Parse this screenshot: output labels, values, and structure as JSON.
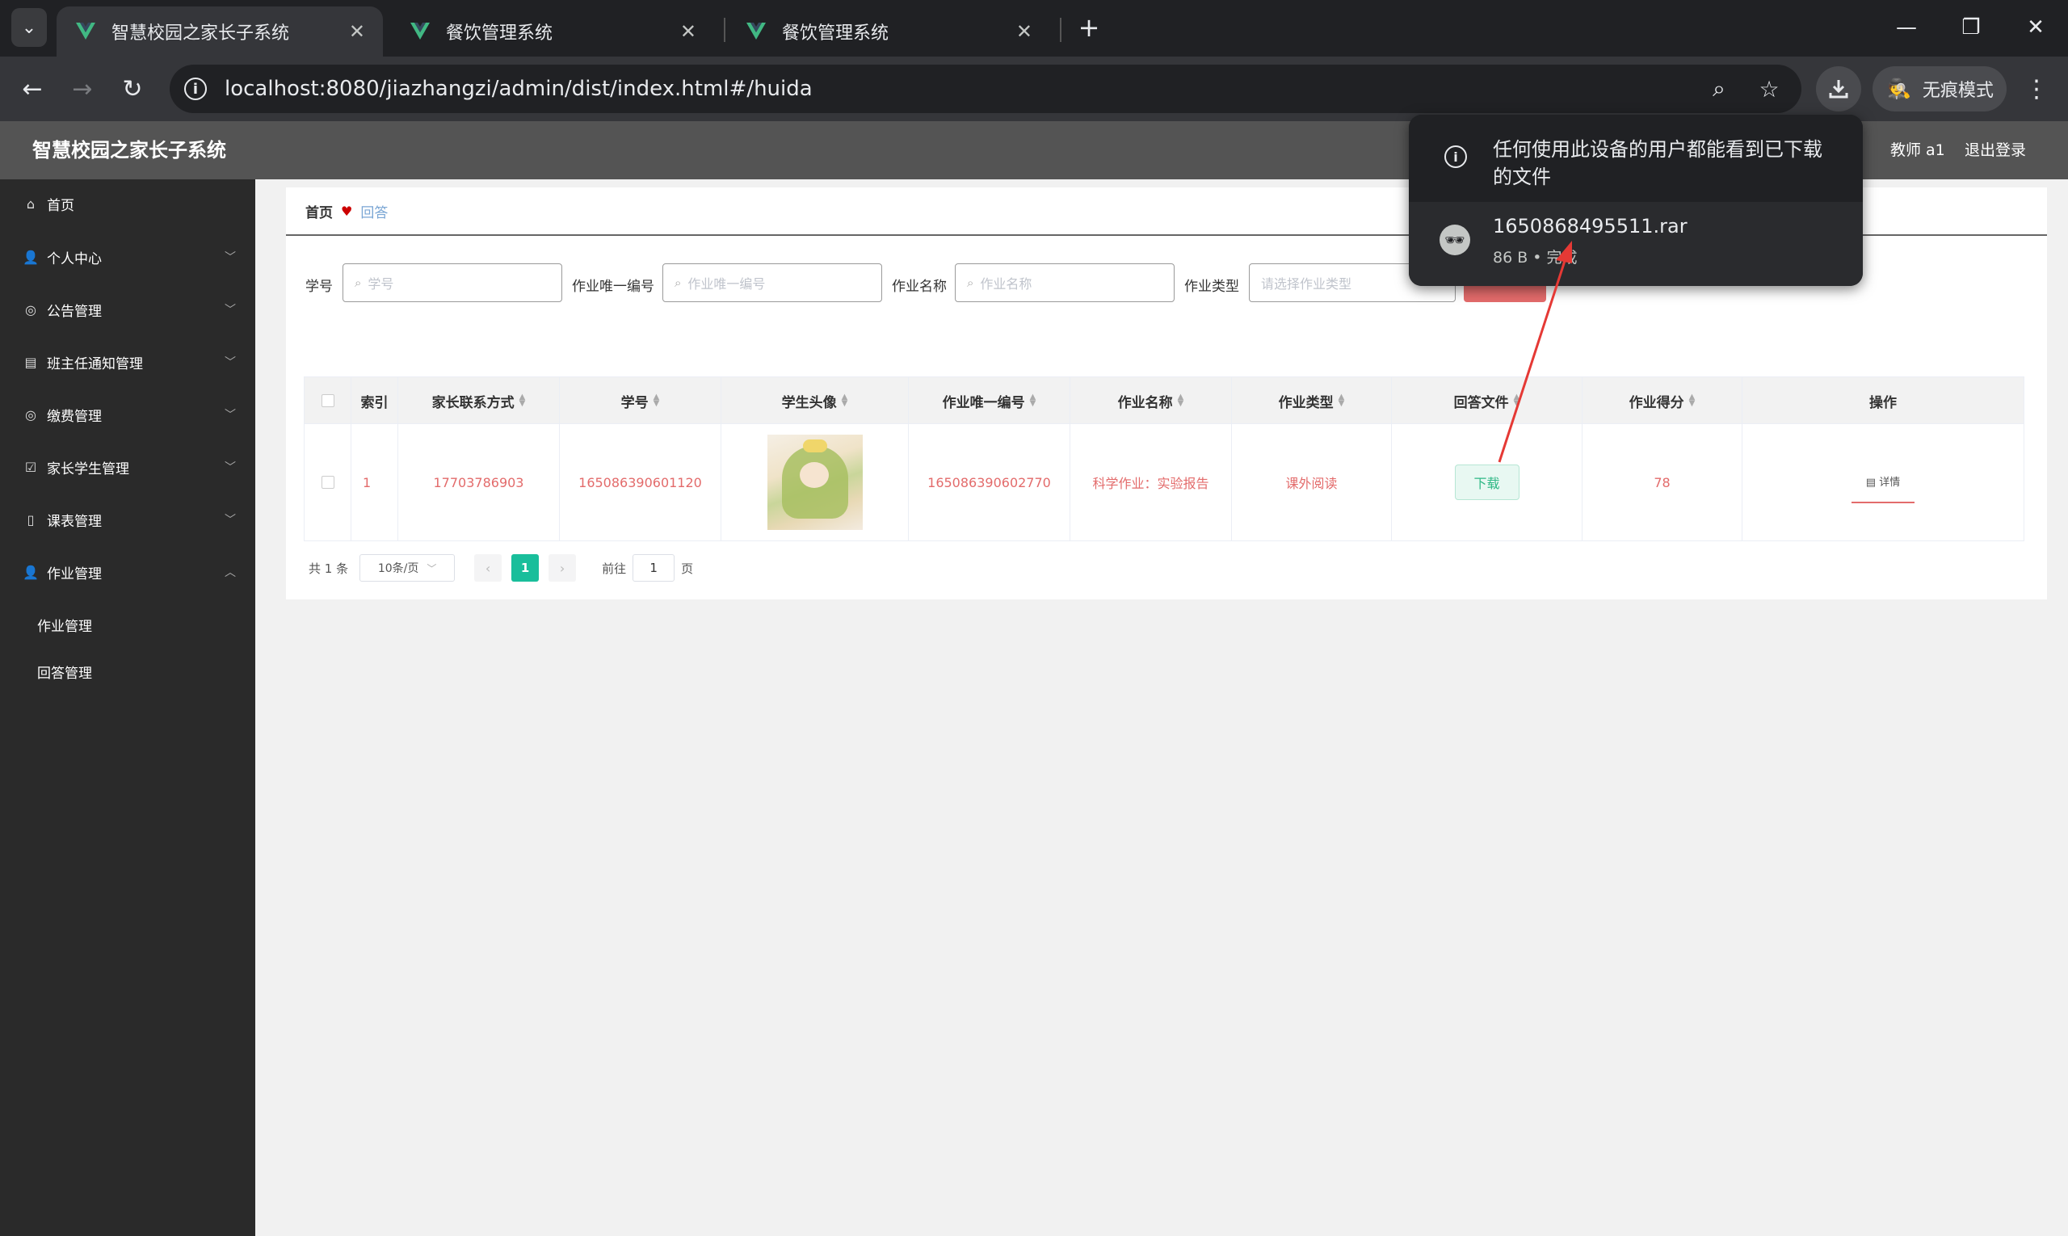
{
  "browser": {
    "tabs": [
      {
        "title": "智慧校园之家长子系统",
        "active": true
      },
      {
        "title": "餐饮管理系统",
        "active": false
      },
      {
        "title": "餐饮管理系统",
        "active": false
      }
    ],
    "url_host": "localhost",
    "url_rest": ":8080/jiazhangzi/admin/dist/index.html#/huida",
    "incognito_label": "无痕模式"
  },
  "download_popup": {
    "warning": "任何使用此设备的用户都能看到已下载的文件",
    "file_name": "1650868495511.rar",
    "file_status": "86 B • 完成"
  },
  "header": {
    "title": "智慧校园之家长子系统",
    "user": "教师 a1",
    "logout": "退出登录"
  },
  "sidebar": {
    "items": [
      {
        "label": "首页",
        "icon": "home-icon"
      },
      {
        "label": "个人中心",
        "icon": "user-icon"
      },
      {
        "label": "公告管理",
        "icon": "globe-icon"
      },
      {
        "label": "班主任通知管理",
        "icon": "clipboard-icon"
      },
      {
        "label": "缴费管理",
        "icon": "globe-icon"
      },
      {
        "label": "家长学生管理",
        "icon": "checklist-icon"
      },
      {
        "label": "课表管理",
        "icon": "phone-icon"
      },
      {
        "label": "作业管理",
        "icon": "user-icon"
      }
    ],
    "sub_items": [
      "作业管理",
      "回答管理"
    ]
  },
  "breadcrumb": {
    "home": "首页",
    "current": "回答"
  },
  "filters": [
    {
      "label": "学号",
      "placeholder": "学号"
    },
    {
      "label": "作业唯一编号",
      "placeholder": "作业唯一编号"
    },
    {
      "label": "作业名称",
      "placeholder": "作业名称"
    },
    {
      "label": "作业类型",
      "placeholder": "请选择作业类型"
    }
  ],
  "table": {
    "headers": [
      "索引",
      "家长联系方式",
      "学号",
      "学生头像",
      "作业唯一编号",
      "作业名称",
      "作业类型",
      "回答文件",
      "作业得分",
      "操作"
    ],
    "rows": [
      {
        "index": "1",
        "parent_phone": "17703786903",
        "student_no": "165086390601120",
        "homework_id": "165086390602770",
        "homework_name": "科学作业：实验报告",
        "homework_type": "课外阅读",
        "answer_file": "下载",
        "score": "78",
        "action": "详情"
      }
    ]
  },
  "pagination": {
    "total": "共 1 条",
    "page_size": "10条/页",
    "current_page": "1",
    "goto_label": "前往",
    "goto_value": "1",
    "page_suffix": "页"
  },
  "colors": {
    "accent_red": "#e36b6b",
    "accent_green": "#19be9b",
    "header_bg": "#545454",
    "sidebar_bg": "#2a2a2a"
  }
}
